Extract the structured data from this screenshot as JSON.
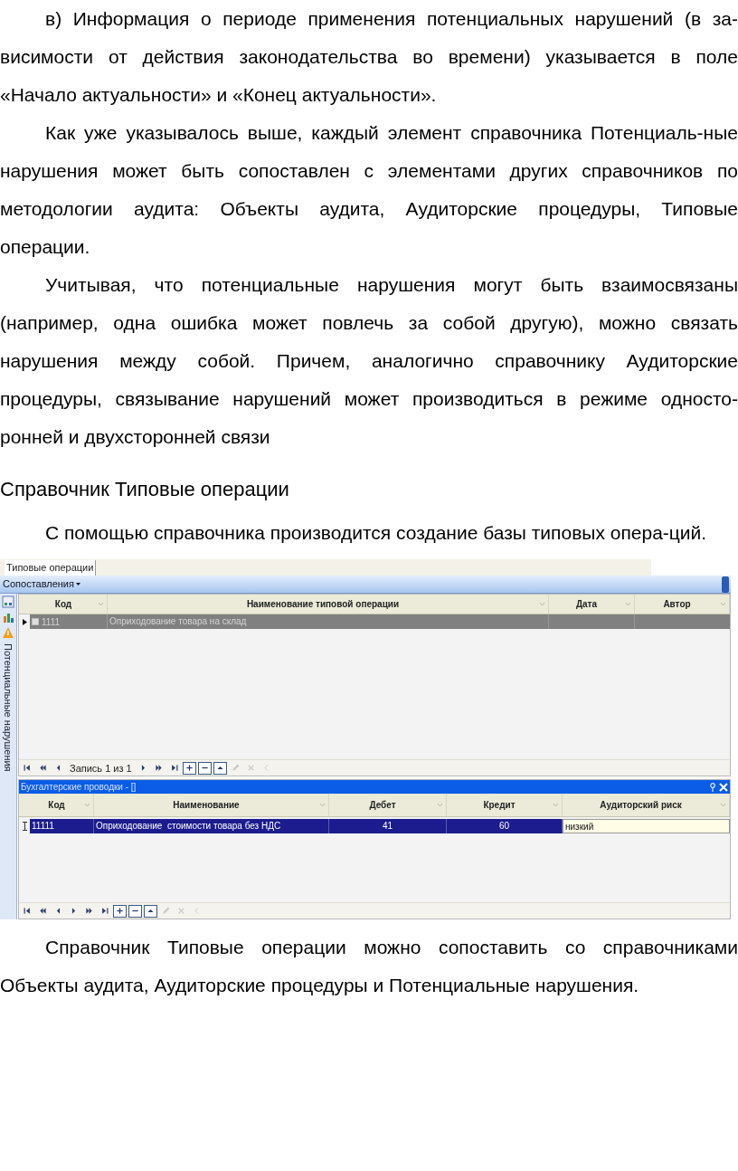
{
  "blocks_before": [
    {
      "kind": "paragraph",
      "text": "в) Информация о периоде применения потенциальных нарушений (в за-висимости от действия законодательства во времени) указывается в поле «Начало актуальности» и «Конец актуальности»."
    },
    {
      "kind": "paragraph",
      "text": "Как уже указывалось выше, каждый элемент справочника Потенциаль-ные нарушения может быть сопоставлен с элементами других справочников по методологии аудита: Объекты аудита, Аудиторские процедуры, Типовые операции."
    },
    {
      "kind": "paragraph",
      "text": "Учитывая, что потенциальные нарушения могут быть взаимосвязаны (например, одна ошибка может повлечь за собой другую), можно связать нарушения между собой. Причем, аналогично справочнику Аудиторские процедуры, связывание нарушений может производиться в режиме односто-ронней и двухсторонней связи"
    },
    {
      "kind": "heading",
      "text": "Справочник Типовые операции"
    },
    {
      "kind": "paragraph",
      "text": "С помощью справочника производится создание базы типовых опера-ций."
    }
  ],
  "app_window": {
    "tab": {
      "label": "Типовые операции",
      "selected": true
    },
    "menu": {
      "label": "Сопоставления"
    },
    "side_label": "Потенциальные нарушения",
    "main_grid": {
      "columns": [
        "Код",
        "Наименование типовой операции",
        "Дата",
        "Автор"
      ],
      "rows": [
        {
          "code": "1111",
          "name": "Оприходование товара на склад",
          "checked": false,
          "selected": true
        }
      ],
      "navigator": {
        "record_text": "Запись 1 из 1",
        "buttons": [
          {
            "kind": "first",
            "disabled": false
          },
          {
            "kind": "prev-page",
            "disabled": false
          },
          {
            "kind": "prev",
            "disabled": false
          },
          {
            "kind": "record"
          },
          {
            "kind": "next",
            "disabled": false
          },
          {
            "kind": "next-page",
            "disabled": false
          },
          {
            "kind": "last",
            "disabled": false
          },
          {
            "kind": "add",
            "disabled": false
          },
          {
            "kind": "remove",
            "disabled": false
          },
          {
            "kind": "up",
            "disabled": false
          },
          {
            "kind": "edit",
            "disabled": true
          },
          {
            "kind": "cancel",
            "disabled": true
          },
          {
            "kind": "back",
            "disabled": true
          }
        ]
      }
    },
    "detail_panel": {
      "title": "Бухгалтерские проводки - []",
      "columns": [
        "Код",
        "Наименование",
        "Дебет",
        "Кредит",
        "Аудиторский риск"
      ],
      "rows": [
        {
          "cells": [
            "11111",
            "Оприходование  стоимости товара без НДС",
            "41",
            "60",
            "низкий"
          ],
          "selected": true
        }
      ],
      "navigator": {
        "buttons": [
          {
            "kind": "first",
            "disabled": false
          },
          {
            "kind": "prev-page",
            "disabled": false
          },
          {
            "kind": "prev",
            "disabled": false
          },
          {
            "kind": "next",
            "disabled": false
          },
          {
            "kind": "next-page",
            "disabled": false
          },
          {
            "kind": "last",
            "disabled": false
          },
          {
            "kind": "add",
            "disabled": false
          },
          {
            "kind": "remove",
            "disabled": false
          },
          {
            "kind": "up",
            "disabled": false
          },
          {
            "kind": "edit",
            "disabled": true
          },
          {
            "kind": "cancel",
            "disabled": true
          },
          {
            "kind": "back",
            "disabled": true
          }
        ]
      }
    }
  },
  "blocks_after": [
    {
      "kind": "paragraph",
      "text": "Справочник Типовые операции можно сопоставить со справочниками Объекты аудита, Аудиторские процедуры и Потенциальные нарушения."
    }
  ]
}
